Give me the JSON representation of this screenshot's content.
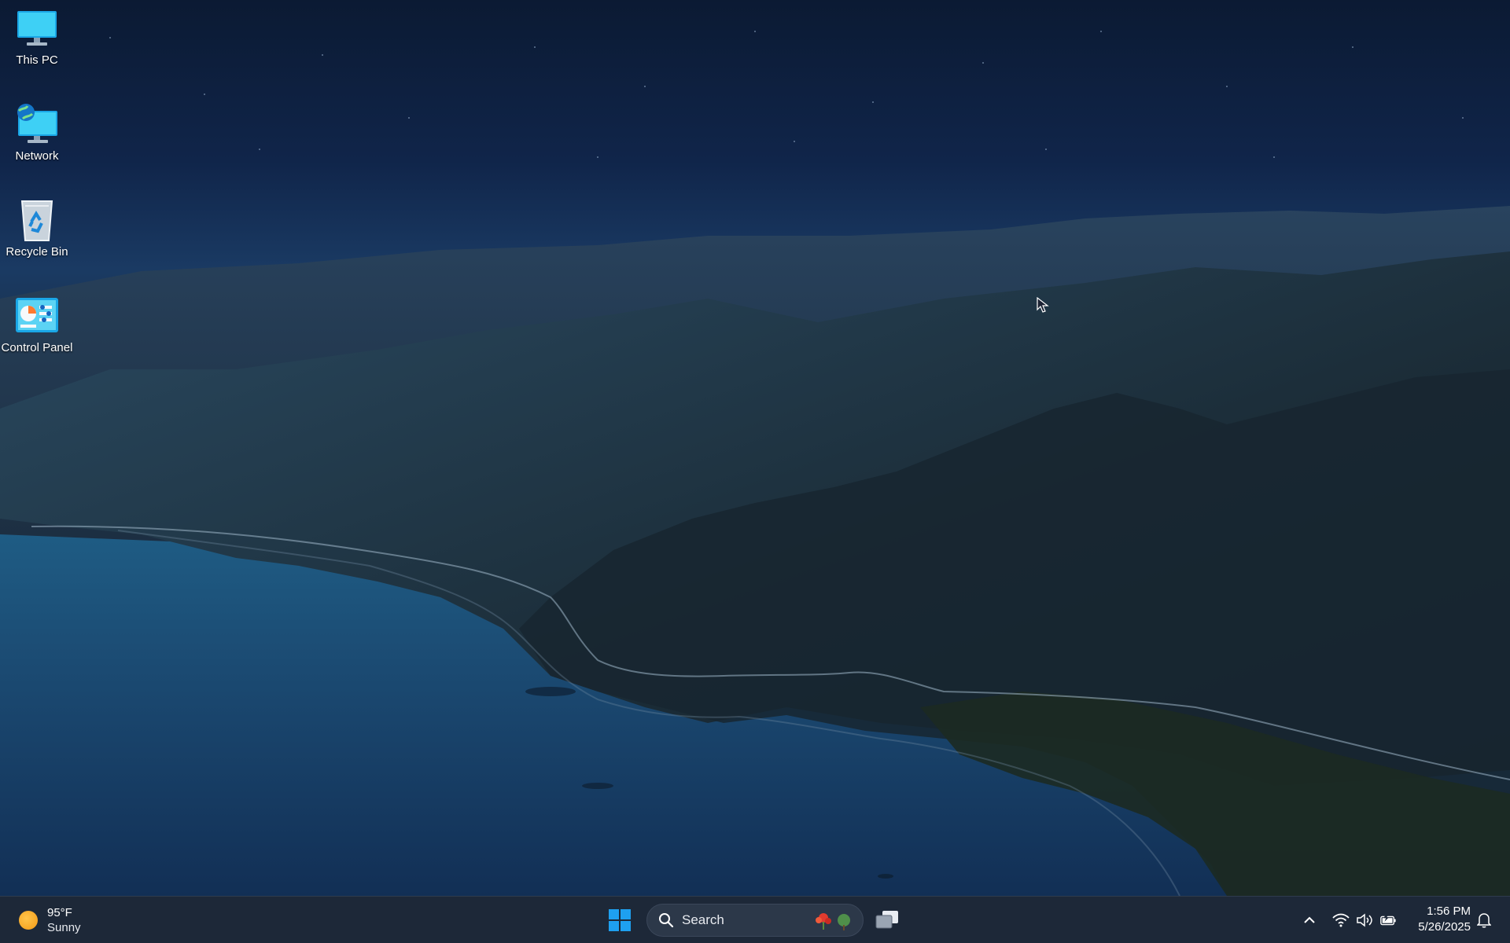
{
  "desktop": {
    "icons": [
      {
        "label": "This PC",
        "icon": "computer-monitor-icon"
      },
      {
        "label": "Network",
        "icon": "network-globe-icon"
      },
      {
        "label": "Recycle Bin",
        "icon": "recycle-bin-icon"
      },
      {
        "label": "Control Panel",
        "icon": "control-panel-icon"
      }
    ]
  },
  "taskbar": {
    "weather": {
      "temperature": "95°F",
      "condition": "Sunny",
      "icon": "sun-icon"
    },
    "start": {
      "icon": "windows-logo-icon"
    },
    "search": {
      "placeholder": "Search",
      "icon": "search-icon"
    },
    "apps": [
      {
        "icon": "task-view-icon"
      }
    ],
    "tray": {
      "icons": [
        "chevron-up-icon",
        "wifi-icon",
        "volume-icon",
        "battery-icon"
      ]
    },
    "clock": {
      "time": "1:56 PM",
      "date": "5/26/2025"
    },
    "notifications": {
      "icon": "bell-icon"
    }
  },
  "colors": {
    "taskbar_bg": "#1d2838",
    "windows_blue": "#1ea0f0",
    "search_bg": "#2c3849"
  }
}
